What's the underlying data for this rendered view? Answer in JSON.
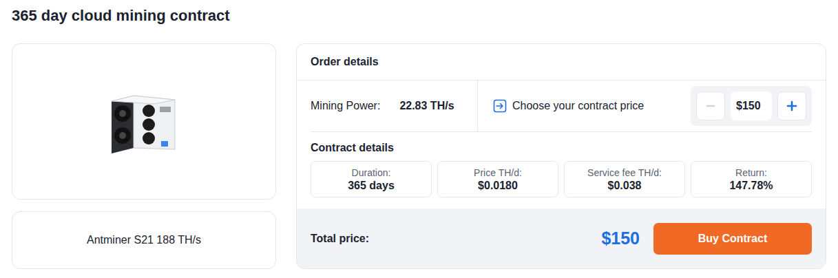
{
  "page": {
    "title": "365 day cloud mining contract"
  },
  "product": {
    "name": "Antminer S21 188 TH/s"
  },
  "order": {
    "title": "Order details",
    "mining_power_label": "Mining Power:",
    "mining_power_value": "22.83 TH/s",
    "price_prompt": "Choose your contract price",
    "price_value": "$150",
    "decrease_disabled": true,
    "increase_disabled": false
  },
  "contract_details": {
    "title": "Contract details",
    "items": [
      {
        "label": "Duration:",
        "value": "365 days"
      },
      {
        "label": "Price TH/d:",
        "value": "$0.0180"
      },
      {
        "label": "Service fee TH/d:",
        "value": "$0.038"
      },
      {
        "label": "Return:",
        "value": "147.78%"
      }
    ]
  },
  "footer": {
    "total_label": "Total price:",
    "total_value": "$150",
    "button": "Buy Contract"
  }
}
